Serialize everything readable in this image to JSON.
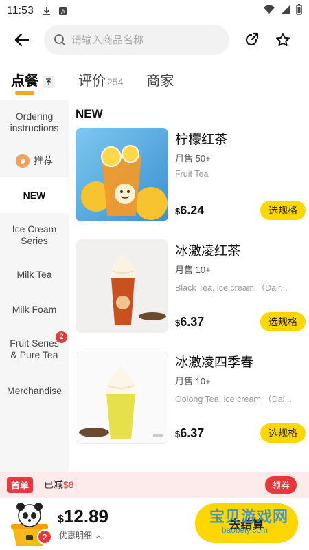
{
  "status_bar": {
    "time": "11:53"
  },
  "search": {
    "placeholder": "请输入商品名称"
  },
  "tabs": [
    {
      "label": "点餐"
    },
    {
      "label": "评价",
      "count": "254"
    },
    {
      "label": "商家"
    }
  ],
  "sidebar": {
    "items": [
      {
        "label": "Ordering instructions"
      },
      {
        "label": "推荐"
      },
      {
        "label": "NEW"
      },
      {
        "label": "Ice Cream Series"
      },
      {
        "label": "Milk Tea"
      },
      {
        "label": "Milk Foam"
      },
      {
        "label": "Fruit Series & Pure Tea",
        "badge": "2"
      },
      {
        "label": "Merchandise"
      }
    ]
  },
  "content": {
    "section_title": "NEW",
    "products": [
      {
        "name": "柠檬红茶",
        "sales": "月售 50+",
        "desc": "Fruit Tea",
        "currency": "$",
        "price": "6.24",
        "button": "选规格"
      },
      {
        "name": "冰激凌红茶",
        "sales": "月售 10+",
        "desc": "Black Tea, ice cream （Dair...",
        "currency": "$",
        "price": "6.37",
        "button": "选规格"
      },
      {
        "name": "冰激凌四季春",
        "sales": "月售 10+",
        "desc": "Oolong Tea, ice cream （Dai...",
        "currency": "$",
        "price": "6.37",
        "button": "选规格"
      }
    ]
  },
  "promo": {
    "first_order": "首单",
    "reduced_label": "已减",
    "reduced_amount": "$8",
    "coupon": "领券"
  },
  "bottom": {
    "cart_badge": "2",
    "currency": "$",
    "total": "12.89",
    "discount_detail": "优惠明细 ︿",
    "checkout": "去结算",
    "watermark": "宝贝游戏网",
    "watermark_url": "baobeiy.com"
  },
  "colors": {
    "accent": "#ffd700",
    "brand_red": "#e5393b",
    "tab_underline": "#f5a623"
  }
}
